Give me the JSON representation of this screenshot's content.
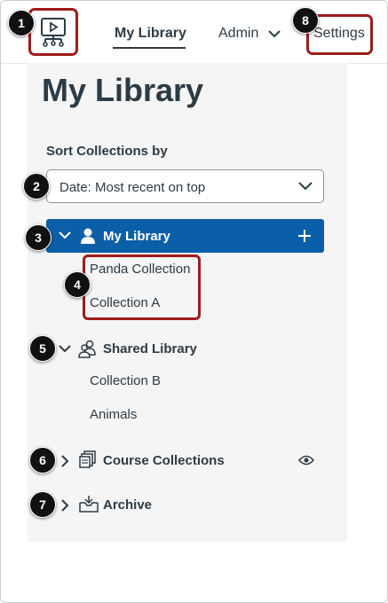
{
  "nav": {
    "my_library": "My Library",
    "admin": "Admin",
    "settings": "Settings"
  },
  "page": {
    "title": "My Library",
    "sort_label": "Sort Collections by",
    "sort_value": "Date: Most recent on top"
  },
  "tree": {
    "my_library": {
      "label": "My Library",
      "collections": [
        "Panda Collection",
        "Collection A"
      ]
    },
    "shared_library": {
      "label": "Shared Library",
      "collections": [
        "Collection B",
        "Animals"
      ]
    },
    "course_collections": {
      "label": "Course Collections"
    },
    "archive": {
      "label": "Archive"
    }
  },
  "callouts": [
    "1",
    "2",
    "3",
    "4",
    "5",
    "6",
    "7",
    "8"
  ],
  "colors": {
    "accent": "#0b5ea8",
    "highlight": "#9e1b1b",
    "text": "#2d3b45"
  }
}
